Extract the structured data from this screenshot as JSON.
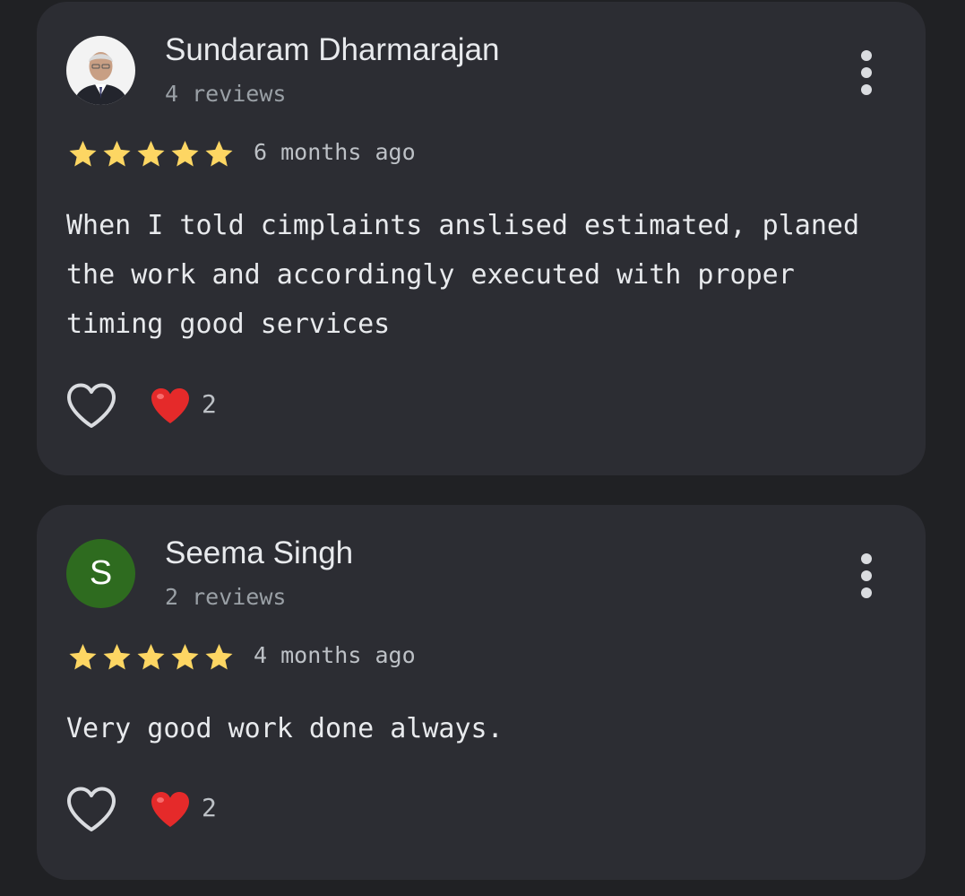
{
  "reviews": [
    {
      "name": "Sundaram Dharmarajan",
      "review_count": "4 reviews",
      "rating": 5,
      "time": "6 months ago",
      "text": "When I told cimplaints anslised estimated, planed the work and accordingly executed with proper timing good services",
      "reactions": "2",
      "avatar_type": "photo"
    },
    {
      "name": "Seema Singh",
      "review_count": "2 reviews",
      "rating": 5,
      "time": "4 months ago",
      "text": "Very good work done always.",
      "reactions": "2",
      "avatar_letter": "S",
      "avatar_color": "#2e6b1f"
    }
  ],
  "colors": {
    "background": "#202124",
    "card": "#2c2d33",
    "star": "#fdd663",
    "heart": "#e52a2a"
  },
  "icons": {
    "more": "more-vert-icon",
    "like": "heart-outline-icon",
    "reaction": "red-heart-icon",
    "star": "star-icon"
  }
}
